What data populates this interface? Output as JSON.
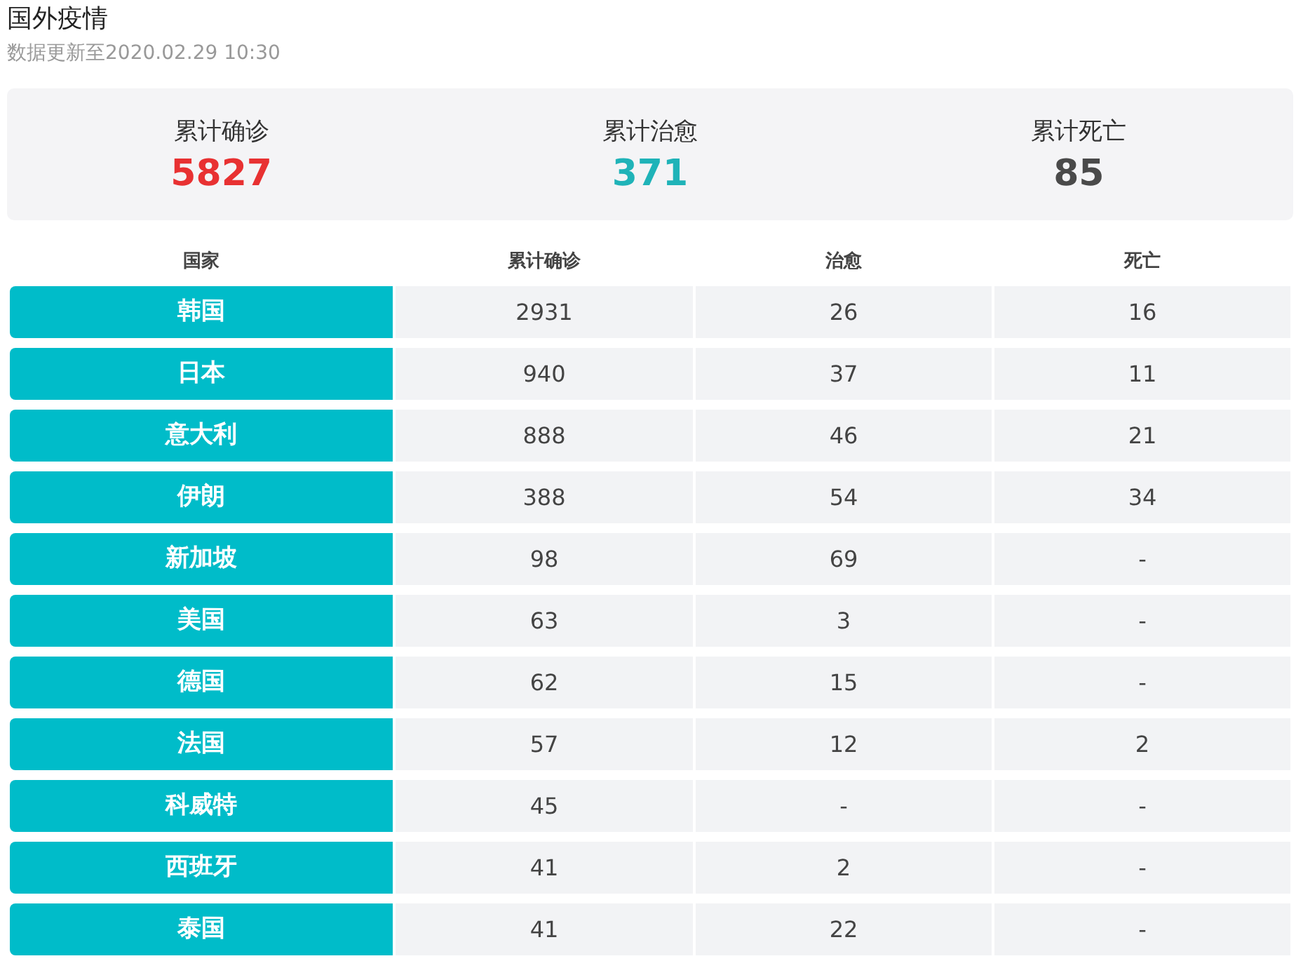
{
  "title": "国外疫情",
  "update_time": "数据更新至2020.02.29 10:30",
  "summary": [
    {
      "label": "累计确诊",
      "value": "5827",
      "kind": "confirmed"
    },
    {
      "label": "累计治愈",
      "value": "371",
      "kind": "cured"
    },
    {
      "label": "累计死亡",
      "value": "85",
      "kind": "dead"
    }
  ],
  "table": {
    "columns": [
      "国家",
      "累计确诊",
      "治愈",
      "死亡"
    ],
    "rows": [
      [
        "韩国",
        "2931",
        "26",
        "16"
      ],
      [
        "日本",
        "940",
        "37",
        "11"
      ],
      [
        "意大利",
        "888",
        "46",
        "21"
      ],
      [
        "伊朗",
        "388",
        "54",
        "34"
      ],
      [
        "新加坡",
        "98",
        "69",
        "-"
      ],
      [
        "美国",
        "63",
        "3",
        "-"
      ],
      [
        "德国",
        "62",
        "15",
        "-"
      ],
      [
        "法国",
        "57",
        "12",
        "2"
      ],
      [
        "科威特",
        "45",
        "-",
        "-"
      ],
      [
        "西班牙",
        "41",
        "2",
        "-"
      ],
      [
        "泰国",
        "41",
        "22",
        "-"
      ]
    ]
  }
}
